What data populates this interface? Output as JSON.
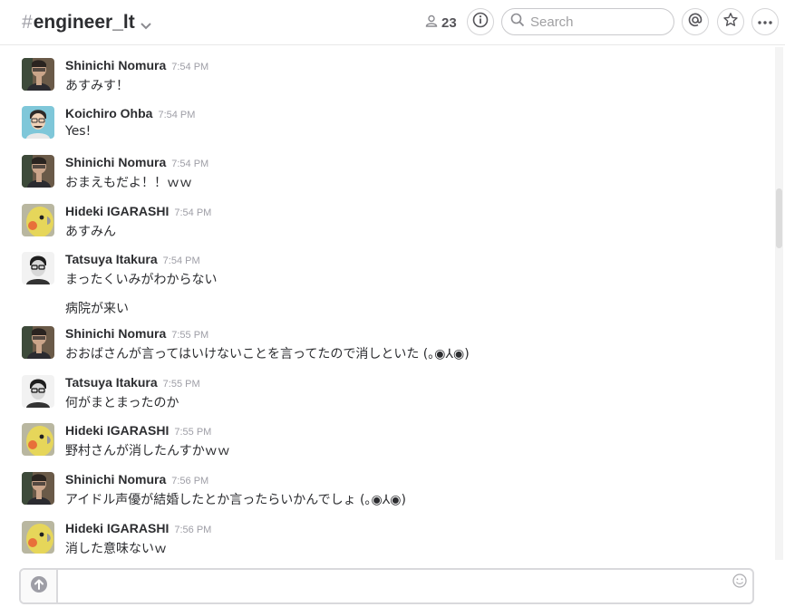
{
  "header": {
    "hash": "#",
    "channel_name": "engineer_lt",
    "member_count": "23"
  },
  "search": {
    "placeholder": "Search"
  },
  "messages": [
    {
      "sender": "Shinichi Nomura",
      "time": "7:54 PM",
      "text": "あすみす！",
      "avatar": "nomura"
    },
    {
      "sender": "Koichiro Ohba",
      "time": "7:54 PM",
      "text": "Yes!",
      "avatar": "ohba"
    },
    {
      "sender": "Shinichi Nomura",
      "time": "7:54 PM",
      "text": "おまえもだよ！！ｗｗ",
      "avatar": "nomura"
    },
    {
      "sender": "Hideki IGARASHI",
      "time": "7:54 PM",
      "text": "あすみん",
      "avatar": "bird"
    },
    {
      "sender": "Tatsuya Itakura",
      "time": "7:54 PM",
      "text": "まったくいみがわからない",
      "text2": "病院が来い",
      "avatar": "itakura"
    },
    {
      "sender": "Shinichi Nomura",
      "time": "7:55 PM",
      "text": "おおばさんが言ってはいけないことを言ってたので消しといた (｡◉⅄◉)",
      "avatar": "nomura"
    },
    {
      "sender": "Tatsuya Itakura",
      "time": "7:55 PM",
      "text": "何がまとまったのか",
      "avatar": "itakura"
    },
    {
      "sender": "Hideki IGARASHI",
      "time": "7:55 PM",
      "text": "野村さんが消したんすかｗｗ",
      "avatar": "bird"
    },
    {
      "sender": "Shinichi Nomura",
      "time": "7:56 PM",
      "text": "アイドル声優が結婚したとか言ったらいかんでしょ (｡◉⅄◉)",
      "avatar": "nomura"
    },
    {
      "sender": "Hideki IGARASHI",
      "time": "7:56 PM",
      "text": "消した意味ないｗ",
      "avatar": "bird"
    }
  ],
  "composer": {
    "value": ""
  },
  "icons": {
    "members": "person-icon",
    "info": "info-icon",
    "search": "search-icon",
    "mentions": "at-icon",
    "star": "star-icon",
    "more": "more-icon",
    "upload": "upload-arrow-icon",
    "emoji": "emoji-icon"
  }
}
